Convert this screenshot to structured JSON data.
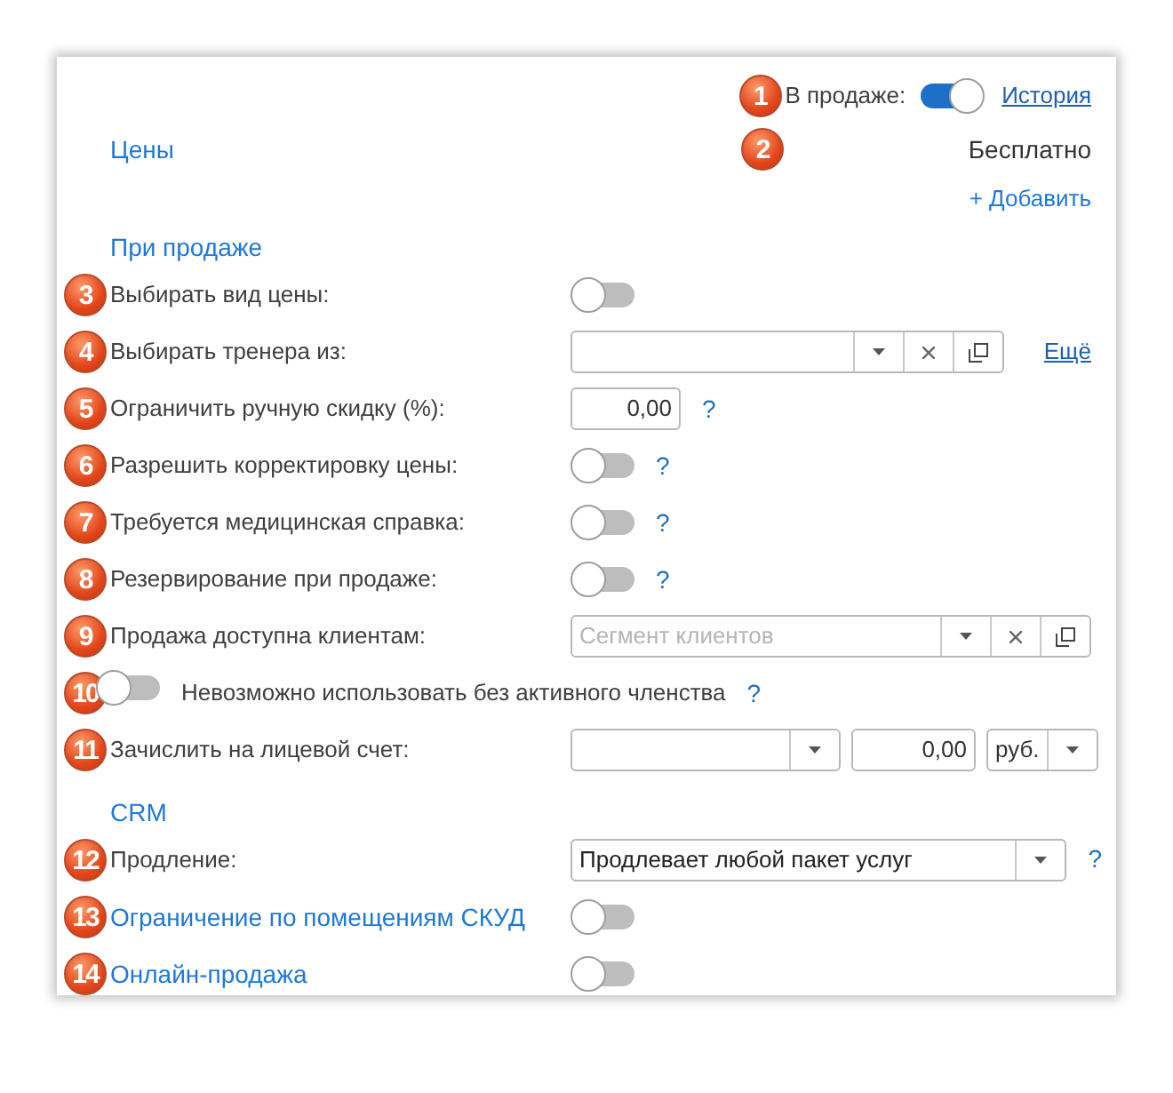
{
  "header": {
    "badge": "1",
    "label": "В продаже:",
    "on": true,
    "link": "История"
  },
  "prices": {
    "title": "Цены",
    "badge": "2",
    "value": "Бесплатно",
    "add": "+ Добавить"
  },
  "sections": [
    {
      "title": "При продаже",
      "rows": [
        {
          "kind": "toggle",
          "badge": "3",
          "label": "Выбирать вид цены:",
          "on": false,
          "link_label": false
        },
        {
          "kind": "combo",
          "badge": "4",
          "label": "Выбирать тренера из:",
          "link": "Ещё",
          "link_label": false
        },
        {
          "kind": "number",
          "badge": "5",
          "label": "Ограничить ручную скидку (%):",
          "value": "0,00",
          "help": "?",
          "link_label": false
        },
        {
          "kind": "toggle",
          "badge": "6",
          "label": "Разрешить корректировку цены:",
          "on": false,
          "help": "?",
          "link_label": false
        },
        {
          "kind": "toggle",
          "badge": "7",
          "label": "Требуется медицинская справка:",
          "on": false,
          "help": "?",
          "link_label": false
        },
        {
          "kind": "toggle",
          "badge": "8",
          "label": "Резервирование при продаже:",
          "on": false,
          "help": "?",
          "link_label": false
        },
        {
          "kind": "combo",
          "badge": "9",
          "label": "Продажа доступна клиентам:",
          "placeholder": "Сегмент клиентов",
          "link_label": false
        },
        {
          "kind": "toggle_inline",
          "badge": "10",
          "label": "Невозможно использовать без активного членства",
          "on": false,
          "help": "?",
          "link_label": false
        },
        {
          "kind": "account",
          "badge": "11",
          "label": "Зачислить на лицевой счет:",
          "amount": "0,00",
          "currency": "руб.",
          "link_label": false
        }
      ]
    },
    {
      "title": "CRM",
      "rows": [
        {
          "kind": "select",
          "badge": "12",
          "label": "Продление:",
          "value": "Продлевает любой пакет услуг",
          "help": "?",
          "link_label": false
        },
        {
          "kind": "toggle",
          "badge": "13",
          "label": "Ограничение по помещениям СКУД",
          "on": false,
          "link_label": true
        },
        {
          "kind": "toggle",
          "badge": "14",
          "label": "Онлайн-продажа",
          "on": false,
          "link_label": true
        }
      ]
    }
  ]
}
